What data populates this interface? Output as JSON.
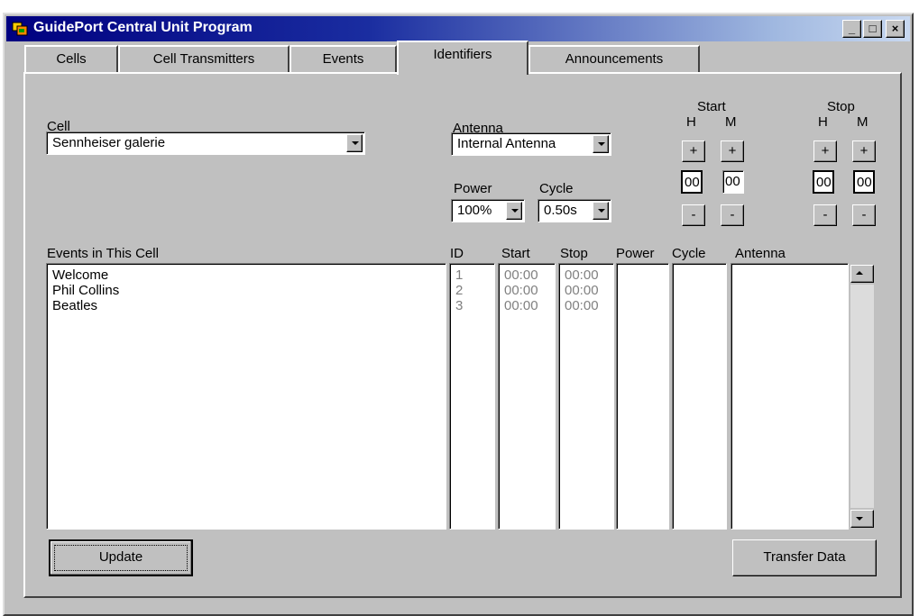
{
  "window": {
    "title": "GuidePort Central Unit Program",
    "controls": {
      "minimize": "_",
      "maximize": "□",
      "close": "×"
    }
  },
  "tabs": [
    {
      "label": "Cells"
    },
    {
      "label": "Cell Transmitters"
    },
    {
      "label": "Events"
    },
    {
      "label": "Identifiers",
      "active": true
    },
    {
      "label": "Announcements"
    }
  ],
  "cell": {
    "label": "Cell",
    "value": "Sennheiser galerie"
  },
  "antenna": {
    "label": "Antenna",
    "value": "Internal Antenna"
  },
  "power": {
    "label": "Power",
    "value": "100%"
  },
  "cycle": {
    "label": "Cycle",
    "value": "0.50s"
  },
  "start_time": {
    "label": "Start",
    "h_label": "H",
    "m_label": "M",
    "plus": "+",
    "minus": "-",
    "hours": "00",
    "minutes": "00"
  },
  "stop_time": {
    "label": "Stop",
    "h_label": "H",
    "m_label": "M",
    "plus": "+",
    "minus": "-",
    "hours": "00",
    "minutes": "00"
  },
  "events": {
    "label": "Events in This Cell",
    "columns": {
      "id": "ID",
      "start": "Start",
      "stop": "Stop",
      "power": "Power",
      "cycle": "Cycle",
      "antenna": "Antenna"
    },
    "rows": [
      {
        "name": "Welcome",
        "id": "1",
        "start": "00:00",
        "stop": "00:00"
      },
      {
        "name": "Phil Collins",
        "id": "2",
        "start": "00:00",
        "stop": "00:00"
      },
      {
        "name": "Beatles",
        "id": "3",
        "start": "00:00",
        "stop": "00:00"
      }
    ]
  },
  "buttons": {
    "update": "Update",
    "transfer": "Transfer Data"
  },
  "colors": {
    "titlebar_start": "#000080",
    "face": "#c0c0c0"
  },
  "icons": {
    "app": "app-window-icon",
    "scroll_up": "arrow-up-icon",
    "scroll_down": "arrow-down-icon"
  }
}
